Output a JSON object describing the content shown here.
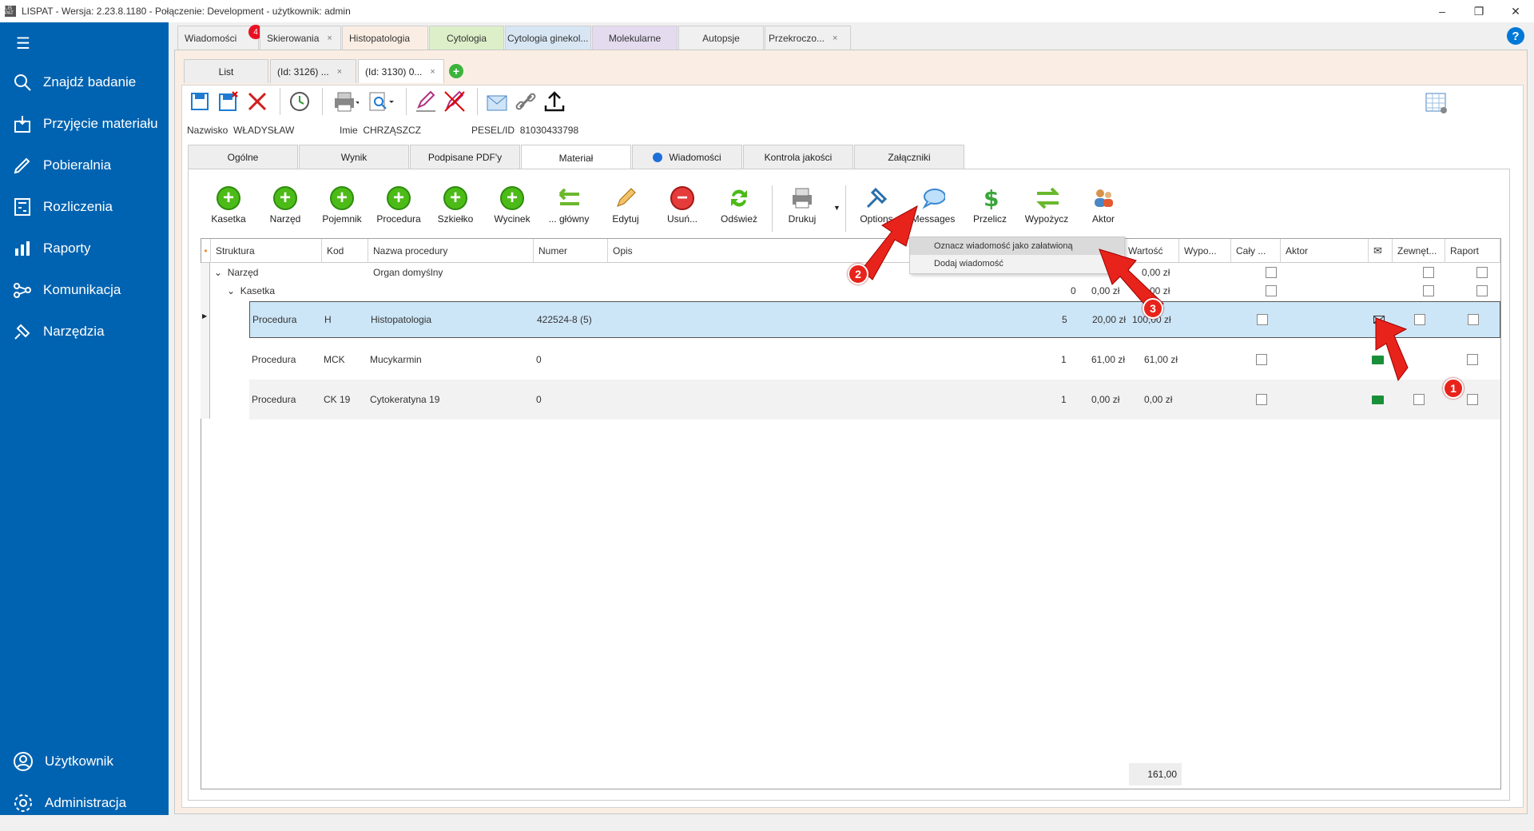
{
  "window": {
    "title": "LISPAT - Wersja: 2.23.8.1180 - Połączenie: Development - użytkownik: admin",
    "icon_text": "LIS PAT"
  },
  "sidebar": {
    "items": [
      {
        "label": "Znajdź badanie",
        "icon": "search-icon"
      },
      {
        "label": "Przyjęcie materiału",
        "icon": "inbox-icon"
      },
      {
        "label": "Pobieralnia",
        "icon": "pen-icon"
      },
      {
        "label": "Rozliczenia",
        "icon": "calculator-icon"
      },
      {
        "label": "Raporty",
        "icon": "bar-chart-icon"
      },
      {
        "label": "Komunikacja",
        "icon": "share-icon"
      },
      {
        "label": "Narzędzia",
        "icon": "tools-icon"
      }
    ],
    "bottom": [
      {
        "label": "Użytkownik",
        "icon": "user-icon"
      },
      {
        "label": "Administracja",
        "icon": "gear-icon"
      }
    ]
  },
  "tabs": [
    {
      "label": "Wiadomości",
      "badge": "4",
      "bg": "#f0f0f0"
    },
    {
      "label": "Skierowania",
      "close": "×",
      "bg": "#f0f0f0"
    },
    {
      "label": "Histopatologia",
      "bg": "#faeee4"
    },
    {
      "label": "Cytologia",
      "bg": "#dcefc8"
    },
    {
      "label": "Cytologia ginekol...",
      "bg": "#d8e6f4"
    },
    {
      "label": "Molekularne",
      "bg": "#e4dbef"
    },
    {
      "label": "Autopsje",
      "bg": "#f0f0f0"
    },
    {
      "label": "Przekroczo...",
      "close": "×",
      "bg": "#f0f0f0"
    }
  ],
  "subtabs": [
    {
      "label": "List"
    },
    {
      "label": "(Id: 3126) ...",
      "close": "×"
    },
    {
      "label": "(Id: 3130) 0...",
      "close": "×"
    }
  ],
  "patient": {
    "surname_label": "Nazwisko",
    "surname": "WŁADYSŁAW",
    "name_label": "Imie",
    "name": "CHRZĄSZCZ",
    "pesel_label": "PESEL/ID",
    "pesel": "81030433798"
  },
  "material_tabs": [
    "Ogólne",
    "Wynik",
    "Podpisane PDF'y",
    "Materiał",
    "Wiadomości",
    "Kontrola jakości",
    "Załączniki"
  ],
  "toolbar": {
    "buttons": [
      "Kasetka",
      "Narzęd",
      "Pojemnik",
      "Procedura",
      "Szkiełko",
      "Wycinek",
      "... główny",
      "Edytuj",
      "Usuń...",
      "Odśwież",
      "Drukuj",
      "Options",
      "Messages",
      "Przelicz",
      "Wypożycz",
      "Aktor"
    ]
  },
  "grid": {
    "headers": [
      "Struktura",
      "Kod",
      "Nazwa procedury",
      "Numer",
      "Opis",
      "Wartość",
      "Wypo...",
      "Cały ...",
      "Aktor",
      "",
      "Zewnęt...",
      "Raport"
    ],
    "rows": [
      {
        "struktura": "Narzęd",
        "kod": "",
        "nazwa": "Organ domyślny",
        "numer": "",
        "ilosc": "",
        "cena": "",
        "wartosc": "0,00 zł"
      },
      {
        "struktura": "Kasetka",
        "kod": "",
        "nazwa": "",
        "numer": "",
        "ilosc": "0",
        "cena": "0,00 zł",
        "wartosc": "0,00 zł"
      },
      {
        "struktura": "Procedura",
        "kod": "H",
        "nazwa": "Histopatologia",
        "numer": "422524-8 (5)",
        "ilosc": "5",
        "cena": "20,00 zł",
        "wartosc": "100,00 zł"
      },
      {
        "struktura": "Procedura",
        "kod": "MCK",
        "nazwa": "Mucykarmin",
        "numer": "0",
        "ilosc": "1",
        "cena": "61,00 zł",
        "wartosc": "61,00 zł"
      },
      {
        "struktura": "Procedura",
        "kod": "CK 19",
        "nazwa": "Cytokeratyna 19",
        "numer": "0",
        "ilosc": "1",
        "cena": "0,00 zł",
        "wartosc": "0,00 zł"
      }
    ],
    "total": "161,00"
  },
  "context_menu": {
    "items": [
      "Oznacz wiadomość jako załatwioną",
      "Dodaj wiadomość"
    ]
  },
  "markers": [
    "1",
    "2",
    "3"
  ],
  "help": "?"
}
